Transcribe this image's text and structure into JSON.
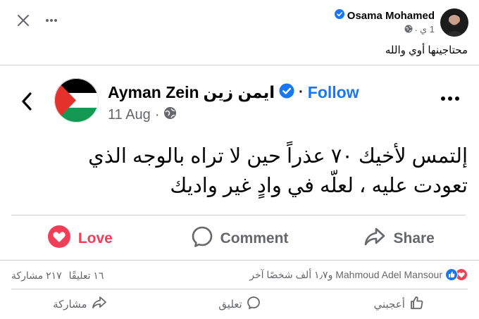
{
  "outer_post": {
    "author": "Osama Mohamed",
    "time": "1 ي",
    "text": "محتاجينها أوي والله",
    "icons": [
      "close-icon",
      "more-icon",
      "verified-badge-icon",
      "globe-icon"
    ]
  },
  "shared_post": {
    "author": "Ayman Zein",
    "author_ar": "ايمن  زين",
    "follow_label": "Follow",
    "date": "11 Aug",
    "text_line1": "إلتمس لأخيك ٧٠ عذراً حين لا تراه بالوجه الذي",
    "text_line2": "تعودت عليه ، لعلّه في وادٍ غير واديك",
    "actions": {
      "love": "Love",
      "comment": "Comment",
      "share": "Share"
    }
  },
  "summary": {
    "reactors": "Mahmoud Adel Mansour و١٫٧ ألف شخصًا آخر",
    "comments": "١٦ تعليقًا",
    "shares": "٢١٧ مشاركة"
  },
  "bottom_actions": {
    "like": "أعجبني",
    "comment": "تعليق",
    "share": "مشاركة"
  },
  "colors": {
    "brand_blue": "#1877f2",
    "love_red": "#f33e58",
    "secondary_text": "#65676b",
    "divider": "#ced0d4"
  }
}
